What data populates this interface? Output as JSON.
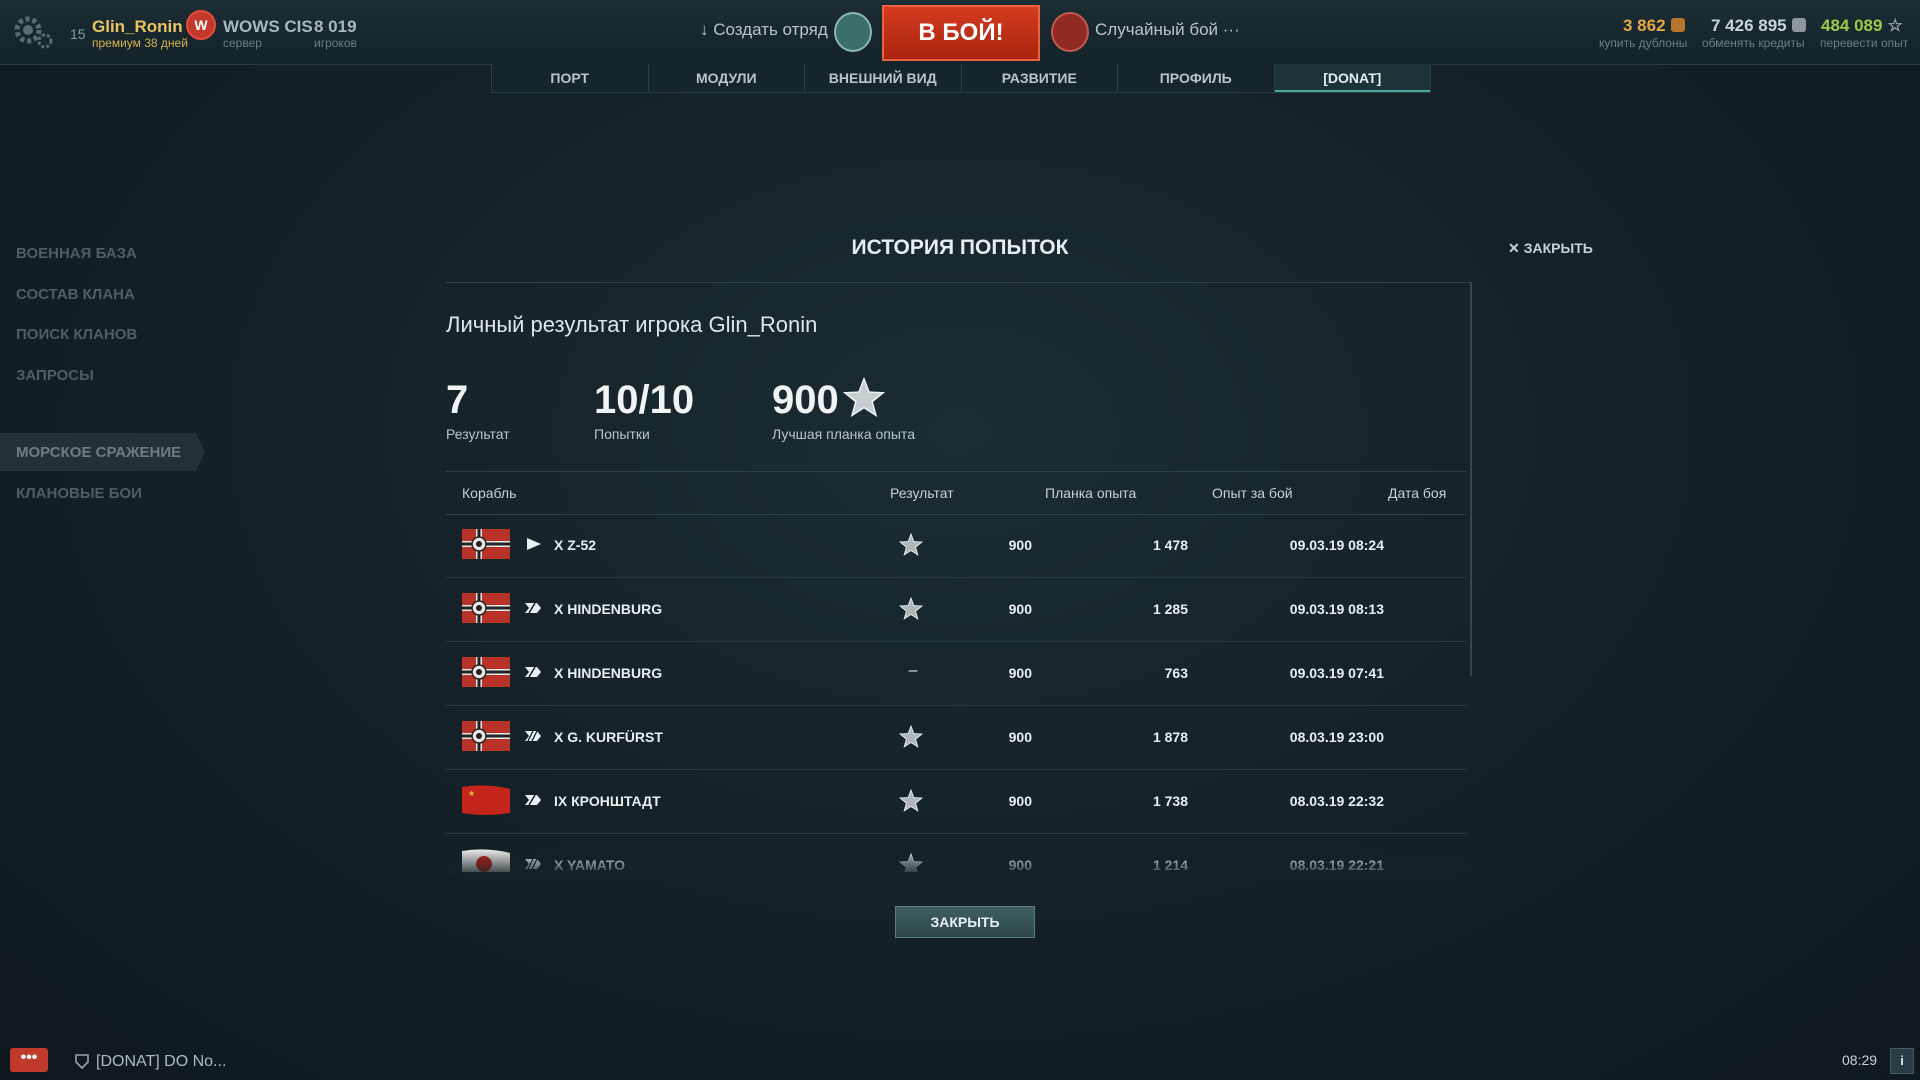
{
  "topbar": {
    "level": "15",
    "username": "Glin_Ronin",
    "premium": "премиум 38 дней",
    "server_name": "WOWS CIS",
    "server_label": "сервер",
    "players_count": "8 019",
    "players_label": "игроков",
    "create_squad": "↓ Создать отряд",
    "battle_button": "В БОЙ!",
    "battle_mode": "Случайный бой ···",
    "currencies": [
      {
        "value": "3 862",
        "label": "купить дублоны",
        "color": "#e6a944"
      },
      {
        "value": "7 426 895",
        "label": "обменять кредиты",
        "color": "#c9d3d8"
      },
      {
        "value": "484 089",
        "label": "перевести опыт",
        "color": "#9ccc44"
      }
    ]
  },
  "nav_tabs": [
    {
      "label": "ПОРТ",
      "active": false
    },
    {
      "label": "МОДУЛИ",
      "active": false
    },
    {
      "label": "ВНЕШНИЙ ВИД",
      "active": false
    },
    {
      "label": "РАЗВИТИЕ",
      "active": false
    },
    {
      "label": "ПРОФИЛЬ",
      "active": false
    },
    {
      "label": "[DONAT]",
      "active": true
    }
  ],
  "sidebar": {
    "items": [
      "ВОЕННАЯ БАЗА",
      "СОСТАВ КЛАНА",
      "ПОИСК КЛАНОВ",
      "ЗАПРОСЫ",
      "МОРСКОЕ СРАЖЕНИЕ",
      "КЛАНОВЫЕ БОИ"
    ],
    "active_index": 4
  },
  "modal": {
    "title": "ИСТОРИЯ ПОПЫТОК",
    "close_top": "ЗАКРЫТЬ",
    "subtitle": "Личный результат игрока Glin_Ronin",
    "stats": [
      {
        "value": "7",
        "label": "Результат"
      },
      {
        "value": "10/10",
        "label": "Попытки"
      },
      {
        "value": "900",
        "label": "Лучшая планка опыта"
      }
    ],
    "columns": {
      "ship": "Корабль",
      "result": "Результат",
      "threshold": "Планка опыта",
      "xp": "Опыт за бой",
      "date": "Дата боя"
    },
    "rows": [
      {
        "nation": "germany",
        "ship_class": "destroyer",
        "ship": "X  Z-52",
        "result": "star",
        "threshold": "900",
        "xp": "1 478",
        "date": "09.03.19 08:24"
      },
      {
        "nation": "germany",
        "ship_class": "cruiser",
        "ship": "X  HINDENBURG",
        "result": "star",
        "threshold": "900",
        "xp": "1 285",
        "date": "09.03.19 08:13"
      },
      {
        "nation": "germany",
        "ship_class": "cruiser",
        "ship": "X  HINDENBURG",
        "result": "–",
        "threshold": "900",
        "xp": "763",
        "date": "09.03.19 07:41"
      },
      {
        "nation": "germany",
        "ship_class": "battleship",
        "ship": "X  G. KURFÜRST",
        "result": "star",
        "threshold": "900",
        "xp": "1 878",
        "date": "08.03.19 23:00"
      },
      {
        "nation": "ussr",
        "ship_class": "cruiser",
        "ship": "IX  КРОНШТАДТ",
        "result": "star",
        "threshold": "900",
        "xp": "1 738",
        "date": "08.03.19 22:32"
      },
      {
        "nation": "japan",
        "ship_class": "battleship",
        "ship": "X  YAMATO",
        "result": "star",
        "threshold": "900",
        "xp": "1 214",
        "date": "08.03.19 22:21"
      }
    ],
    "close_button": "ЗАКРЫТЬ"
  },
  "bottombar": {
    "chat_icon_text": "•••",
    "channel": "[DONAT] DO No...",
    "clock": "08:29",
    "info": "i"
  }
}
